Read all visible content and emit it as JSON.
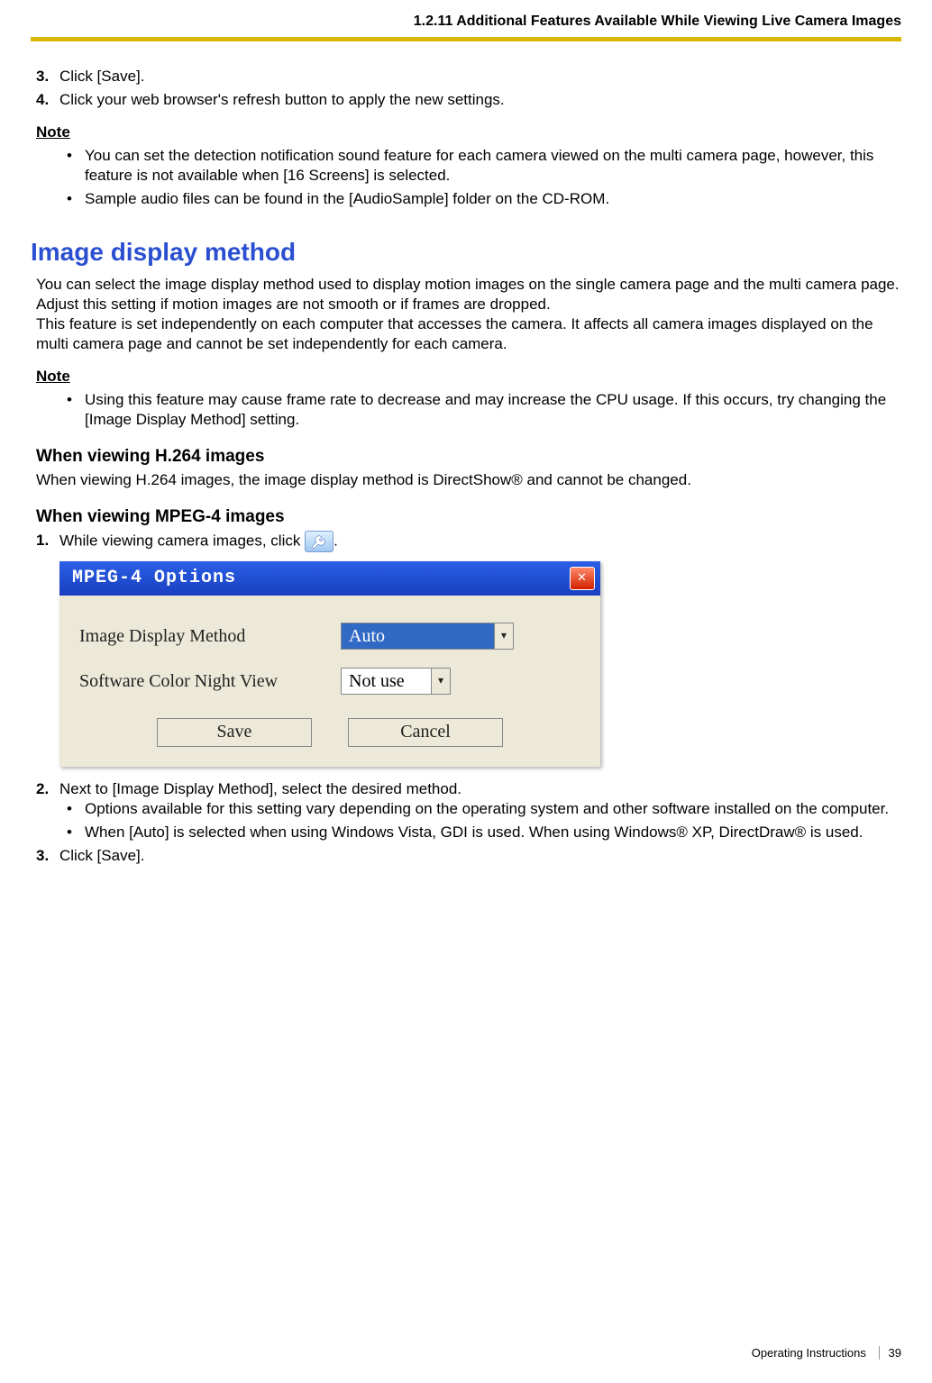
{
  "header": {
    "section_ref": "1.2.11 Additional Features Available While Viewing Live Camera Images"
  },
  "steps_top": [
    {
      "num": "3.",
      "text": "Click [Save]."
    },
    {
      "num": "4.",
      "text": "Click your web browser's refresh button to apply the new settings."
    }
  ],
  "note1": {
    "label": "Note",
    "items": [
      "You can set the detection notification sound feature for each camera viewed on the multi camera page, however, this feature is not available when [16 Screens] is selected.",
      "Sample audio files can be found in the [AudioSample] folder on the CD-ROM."
    ]
  },
  "section_title": "Image display method",
  "intro_para": "You can select the image display method used to display motion images on the single camera page and the multi camera page. Adjust this setting if motion images are not smooth or if frames are dropped.\nThis feature is set independently on each computer that accesses the camera. It affects all camera images displayed on the multi camera page and cannot be set independently for each camera.",
  "note2": {
    "label": "Note",
    "items": [
      "Using this feature may cause frame rate to decrease and may increase the CPU usage. If this occurs, try changing the [Image Display Method] setting."
    ]
  },
  "h264": {
    "heading": "When viewing H.264 images",
    "text": "When viewing H.264 images, the image display method is DirectShow® and cannot be changed."
  },
  "mpeg4": {
    "heading": "When viewing MPEG-4 images",
    "step1_prefix": "While viewing camera images, click ",
    "step1_suffix": "."
  },
  "dialog": {
    "title": "MPEG-4 Options",
    "row1_label": "Image Display Method",
    "row1_value": "Auto",
    "row2_label": "Software Color Night View",
    "row2_value": "Not use",
    "save": "Save",
    "cancel": "Cancel"
  },
  "steps_bottom": {
    "step2": {
      "num": "2.",
      "text": "Next to [Image Display Method], select the desired method.",
      "bullets": [
        "Options available for this setting vary depending on the operating system and other software installed on the computer.",
        "When [Auto] is selected when using Windows Vista, GDI is used. When using Windows® XP, DirectDraw® is used."
      ]
    },
    "step3": {
      "num": "3.",
      "text": "Click [Save]."
    }
  },
  "footer": {
    "doc": "Operating Instructions",
    "page": "39"
  }
}
